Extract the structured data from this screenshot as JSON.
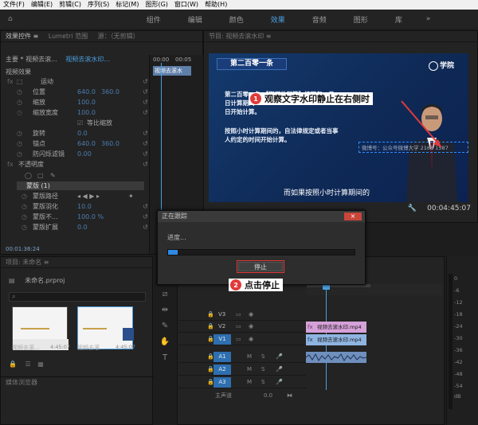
{
  "menu": [
    "文件(F)",
    "编辑(E)",
    "剪辑(C)",
    "序列(S)",
    "标记(M)",
    "图形(G)",
    "窗口(W)",
    "帮助(H)"
  ],
  "workspaces": [
    {
      "label": "组件",
      "active": false
    },
    {
      "label": "编辑",
      "active": false
    },
    {
      "label": "颜色",
      "active": false
    },
    {
      "label": "效果",
      "active": true
    },
    {
      "label": "音频",
      "active": false
    },
    {
      "label": "图形",
      "active": false
    },
    {
      "label": "库",
      "active": false
    }
  ],
  "effect_controls": {
    "tabs": [
      "效果控件 ≡",
      "Lumetri 范围",
      "源：（无剪辑）"
    ],
    "master_label": "主要 * 视频去滚...",
    "clip_label": "视频去滚水印...",
    "ruler_time": "00:00",
    "ruler_time2": "00:05",
    "clip_chip": "视频去滚水",
    "section": "视频效果",
    "motion": "运动",
    "position": {
      "label": "位置",
      "x": "640.0",
      "y": "360.0"
    },
    "scale": {
      "label": "缩放",
      "value": "100.0"
    },
    "scale_width": {
      "label": "缩放宽度",
      "value": "100.0"
    },
    "uniform": "等比缩放",
    "rotation": {
      "label": "旋转",
      "value": "0.0"
    },
    "anchor": {
      "label": "锚点",
      "x": "640.0",
      "y": "360.0"
    },
    "anti_flicker": {
      "label": "防闪烁滤镜",
      "value": "0.00"
    },
    "opacity": "不透明度",
    "mask": "蒙版 (1)",
    "mask_path": "蒙版路径",
    "mask_feather": {
      "label": "蒙版羽化",
      "value": "10.0"
    },
    "mask_opacity": {
      "label": "蒙版不...",
      "value": "100.0 %"
    },
    "mask_expansion": {
      "label": "蒙版扩展",
      "value": "0.0"
    },
    "timecode": "00:01:36:24"
  },
  "program_monitor": {
    "title": "节目: 视频去滚水印 ≡",
    "timecode": "00:04:45:07",
    "slide_title": "第二百零一条",
    "slide_line1": "第二百零一条 【期间的起算】按照年、月、",
    "slide_line2": "日计算期间",
    "slide_line3": "日开始计算。",
    "slide_line4": "按照小时计算期间的，自法律规定或者当事",
    "slide_line5": "人约定的时间开始计算。",
    "logo": "学院",
    "watermark": "微博号：公众号微博大学 2168 1587",
    "subtitle": "而如果按照小时计算期间的"
  },
  "annotations": {
    "note1_num": "1",
    "note1_text": "观察文字水印静止在右侧时",
    "note2_num": "2",
    "note2_text": "点击停止"
  },
  "dialog": {
    "title": "正在跟踪",
    "close": "×",
    "progress_label": "进度...",
    "progress": 0.05,
    "stop_button": "停止"
  },
  "project": {
    "title": "项目: 未命名 ≡",
    "file": "未命名.prproj",
    "items": [
      {
        "name": "视频去滚...",
        "duration": "4:45:07"
      },
      {
        "name": "视频去滚...",
        "duration": "4:45:07"
      }
    ],
    "media_browser": "媒体浏览器"
  },
  "timeline": {
    "tracks": [
      {
        "id": "V3",
        "target": false
      },
      {
        "id": "V2",
        "target": false
      },
      {
        "id": "V1",
        "target": true
      },
      {
        "id": "A1",
        "target": true
      },
      {
        "id": "A2",
        "target": true
      },
      {
        "id": "A3",
        "target": true
      }
    ],
    "master": "主声道",
    "master_value": "0.0",
    "clip_fx": "视频去滚水印.mp4",
    "clip_v1": "视频去滚水印.mp4"
  },
  "meter_scale": [
    "0",
    "-6",
    "-12",
    "-18",
    "-24",
    "-30",
    "-36",
    "-42",
    "-48",
    "-54",
    "dB"
  ],
  "colors": {
    "accent": "#4a9fe0",
    "highlight": "#e23a3a",
    "clip_pink": "#d6a1d8",
    "clip_blue": "#8fb4e0"
  }
}
